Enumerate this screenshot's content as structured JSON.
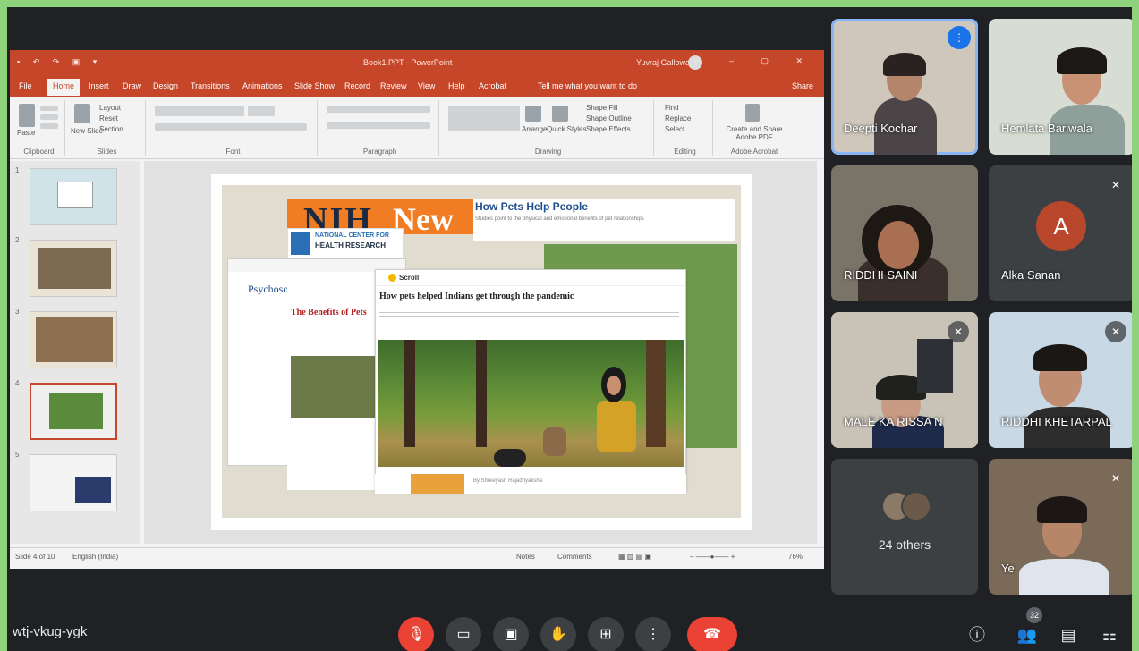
{
  "meeting": {
    "code": "wtj-vkug-ygk",
    "participant_badge": "32"
  },
  "ppt": {
    "window_title": "Book1.PPT - PowerPoint",
    "user": "Yuvraj Gallowa",
    "tabs": [
      "File",
      "Home",
      "Insert",
      "Draw",
      "Design",
      "Transitions",
      "Animations",
      "Slide Show",
      "Record",
      "Review",
      "View",
      "Help",
      "Acrobat"
    ],
    "active_tab": "Home",
    "tell_me": "Tell me what you want to do",
    "share": "Share",
    "ribbon_groups": [
      "Clipboard",
      "Slides",
      "Font",
      "Paragraph",
      "Drawing",
      "Editing",
      "Adobe Acrobat"
    ],
    "ribbon_buttons": {
      "paste": "Paste",
      "new_slide": "New Slide",
      "layout": "Layout",
      "reset": "Reset",
      "section": "Section",
      "arrange": "Arrange",
      "quick_styles": "Quick Styles",
      "shape_fill": "Shape Fill",
      "shape_outline": "Shape Outline",
      "shape_effects": "Shape Effects",
      "find": "Find",
      "replace": "Replace",
      "select": "Select",
      "create_pdf": "Create and Share Adobe PDF"
    },
    "slide_numbers": [
      "1",
      "2",
      "3",
      "4",
      "5"
    ],
    "selected_slide": 4,
    "status": {
      "slide_info": "Slide 4 of 10",
      "language": "English (India)",
      "notes": "Notes",
      "comments": "Comments",
      "zoom": "76%"
    }
  },
  "slide": {
    "nih_left": "NIH",
    "nih_right": "New",
    "pets_title": "How Pets Help People",
    "pets_sub": "Studies point to the physical and emotional benefits of pet relationships",
    "nch_line1": "NATIONAL CENTER FOR",
    "nch_line2": "HEALTH RESEARCH",
    "article1_title": "Psychosomatic",
    "article2_title": "The Benefits of Pets",
    "scroll_logo": "Scroll",
    "scroll_headline": "How pets helped Indians get through the pandemic",
    "byline": "By Shreeyash Rajadhyaksha"
  },
  "participants": [
    {
      "name": "Deepti Kochar",
      "status": "speaking"
    },
    {
      "name": "Hemlata Bariwala",
      "status": "on"
    },
    {
      "name": "RIDDHI SAINI",
      "status": "on"
    },
    {
      "name": "Alka Sanan",
      "status": "muted",
      "avatar_letter": "A"
    },
    {
      "name": "MALE KA RISSA N",
      "status": "muted"
    },
    {
      "name": "RIDDHI KHETARPAL",
      "status": "muted"
    },
    {
      "name": "24 others",
      "status": "group"
    },
    {
      "name": "Ye",
      "status": "muted"
    }
  ],
  "controls": {
    "mic": "mic-off",
    "camera": "camera",
    "captions": "captions",
    "raise_hand": "raise-hand",
    "present": "present",
    "more": "more",
    "end": "end-call",
    "info": "info",
    "people": "people",
    "chat": "chat",
    "activities": "activities"
  },
  "colors": {
    "meet_bg": "#202124",
    "tile_bg": "#3c4043",
    "end_call": "#ea4335",
    "ppt_accent": "#c6462a",
    "speaking": "#1a73e8",
    "frame": "#8fd27c"
  }
}
